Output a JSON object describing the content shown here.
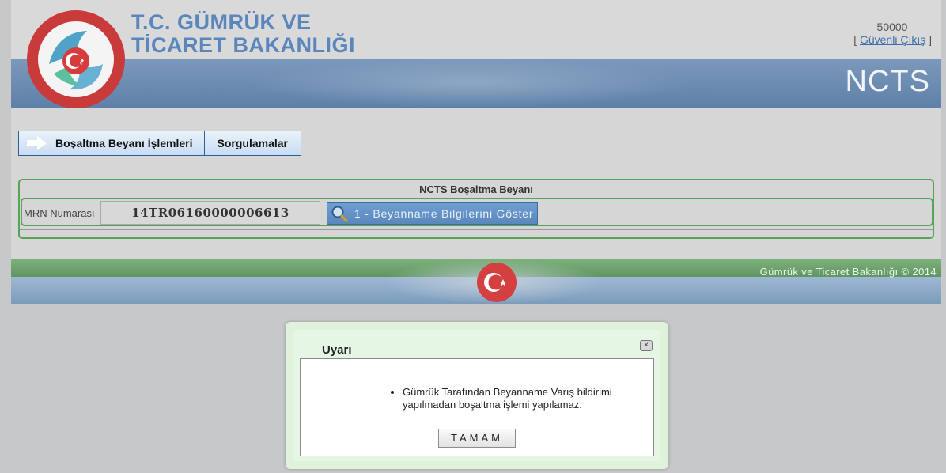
{
  "header": {
    "brand_line1": "T.C. GÜMRÜK VE",
    "brand_line2": "TİCARET BAKANLIĞI",
    "app_name": "NCTS",
    "user_id": "50000",
    "logout_open": "[ ",
    "logout_label": "Güvenli Çıkış",
    "logout_close": " ]",
    "logo_text": "T.C. GÜMRÜK ve TİCARET BAKANLIĞI · MINISTRY OF CUSTOMS AND TRADE"
  },
  "menu": {
    "items": [
      {
        "label": "Boşaltma Beyanı İşlemleri"
      },
      {
        "label": "Sorgulamalar"
      }
    ]
  },
  "panel": {
    "title": "NCTS Boşaltma Beyanı",
    "mrn_label": "MRN Numarası",
    "mrn_value": "14TR06160000006613",
    "show_button_label": "1 - Beyanname Bilgilerini Göster"
  },
  "footer": {
    "copyright": "Gümrük ve Ticaret Bakanlığı © 2014"
  },
  "dialog": {
    "title": "Uyarı",
    "close_symbol": "×",
    "message": "Gümrük Tarafından Beyanname Varış bildirimi yapılmadan boşaltma işlemi yapılamaz.",
    "ok_label": "TAMAM"
  },
  "colors": {
    "brand_blue": "#5a86bd",
    "panel_green": "#58a35a",
    "dialog_green": "#dff3dc"
  }
}
